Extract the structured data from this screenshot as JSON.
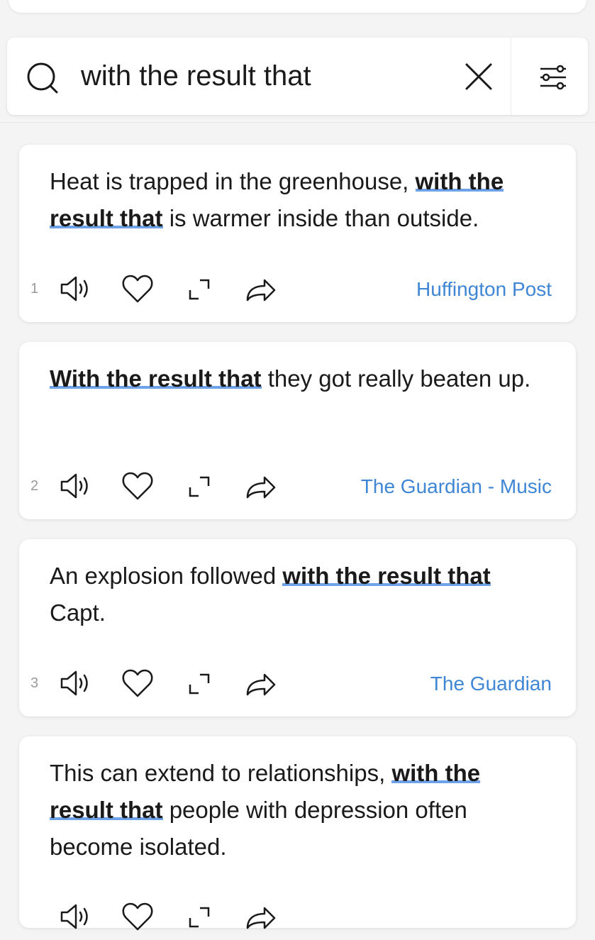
{
  "search": {
    "query": "with the result that",
    "placeholder": "Search"
  },
  "icons": {
    "search": "search-icon",
    "clear": "close-icon",
    "filter": "filter-sliders-icon",
    "speaker": "speaker-icon",
    "heart": "heart-icon",
    "expand": "expand-icon",
    "share": "share-icon"
  },
  "colors": {
    "highlight": "#6ea2e8",
    "source_link": "#3f86d4",
    "background": "#f4f4f4"
  },
  "results": [
    {
      "number": "1",
      "pre": "Heat is trapped in the greenhouse, ",
      "highlight": "with the result that",
      "post": " is warmer inside than outside.",
      "source": "Huffington Post"
    },
    {
      "number": "2",
      "pre": "",
      "highlight": "With the result that",
      "post": " they got really beaten up.",
      "source": "The Guardian - Music"
    },
    {
      "number": "3",
      "pre": "An explosion followed ",
      "highlight": "with the result that",
      "post": " Capt.",
      "source": "The Guardian"
    },
    {
      "number": "",
      "pre": "This can extend to relationships, ",
      "highlight": "with the result that",
      "post": " people with depression often become isolated.",
      "source": ""
    }
  ]
}
